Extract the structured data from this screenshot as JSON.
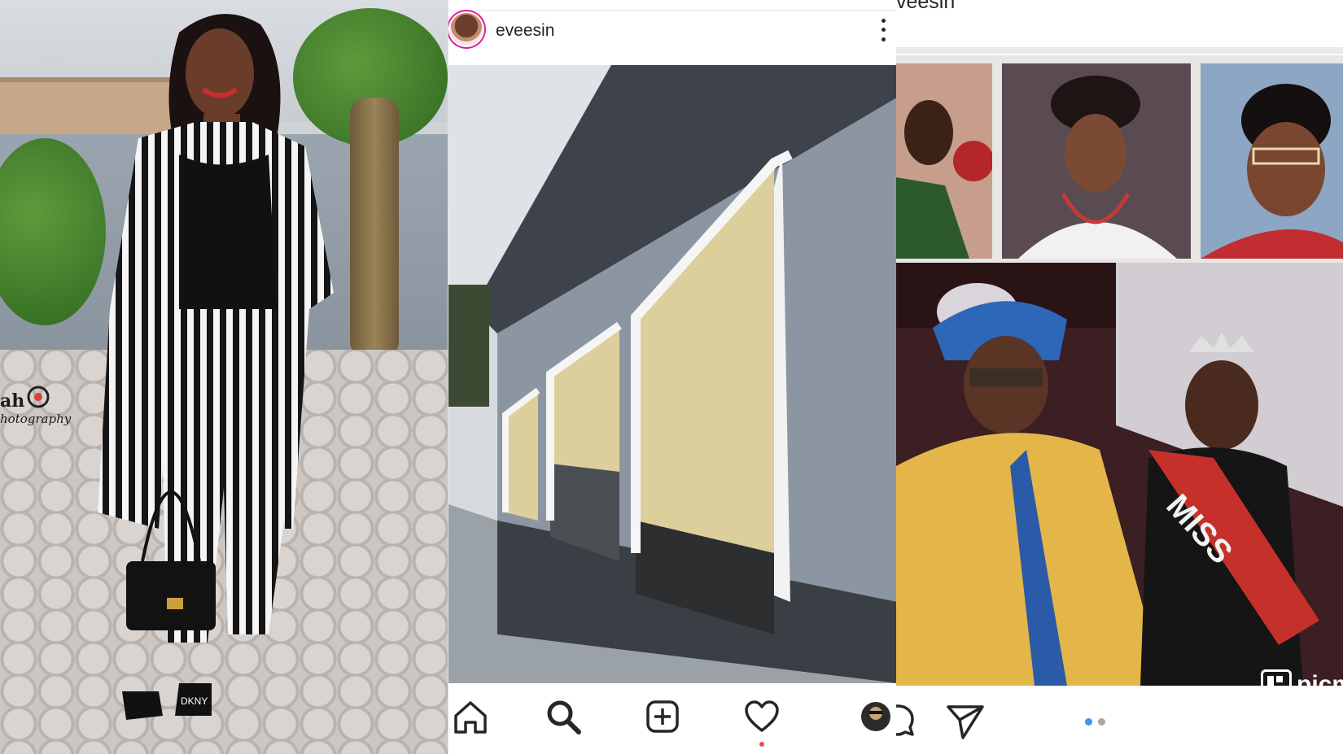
{
  "left_photo": {
    "description_icon": "photo-of-woman-in-striped-outfit",
    "watermark": {
      "text": "ah",
      "logo_icon": "camera-logo-icon",
      "subtext": "hotography"
    },
    "bag_brand": "DKNY"
  },
  "middle_post": {
    "username": "eveesin",
    "more_icon": "more-vertical-icon",
    "image_icon": "photo-of-building-exterior",
    "nav": {
      "home_icon": "home-icon",
      "search_icon": "search-icon",
      "add_icon": "add-post-icon",
      "activity_icon": "heart-icon",
      "profile_icon": "profile-avatar-icon"
    },
    "colors": {
      "notification_dot": "#ed4956"
    }
  },
  "right_post": {
    "username": "veesin",
    "collage_icon": "collage-of-vintage-photos",
    "sash_text": "MISS",
    "watermark": "picm",
    "bottom_bar": {
      "comment_icon": "comment-icon",
      "share_icon": "send-icon",
      "carousel": {
        "active_index": 0,
        "total": 2,
        "active_color": "#3897f0",
        "inactive_color": "#a8a8a8"
      }
    }
  }
}
